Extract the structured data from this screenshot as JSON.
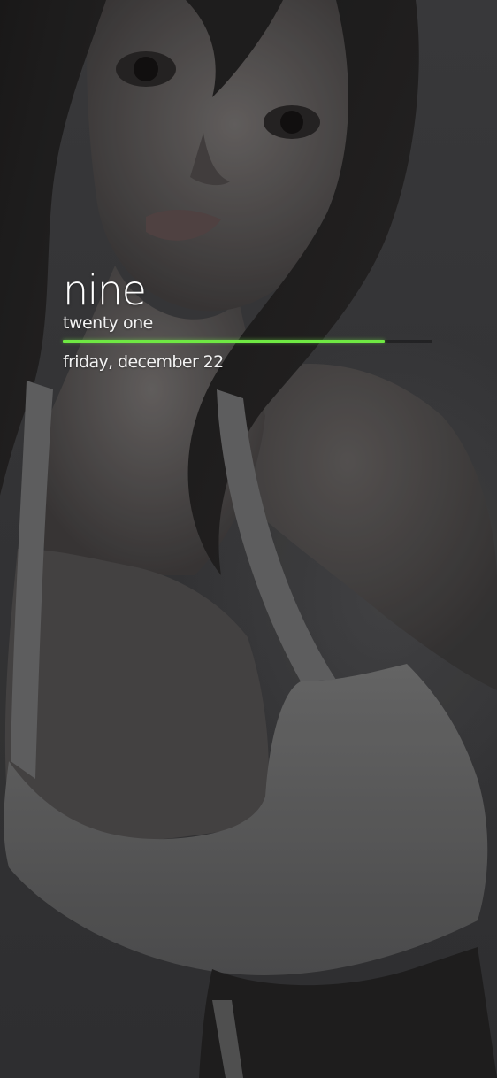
{
  "lockscreen": {
    "time_hour": "nine",
    "time_minute": "twenty one",
    "date": "friday, december 22",
    "progress": 0.87
  },
  "colors": {
    "progress_accent": "#6fe843",
    "text": "#ffffff",
    "background": "#3d3d3f"
  },
  "wallpaper": {
    "subject": "illustrated portrait of a dark-haired woman in a white tank top"
  }
}
